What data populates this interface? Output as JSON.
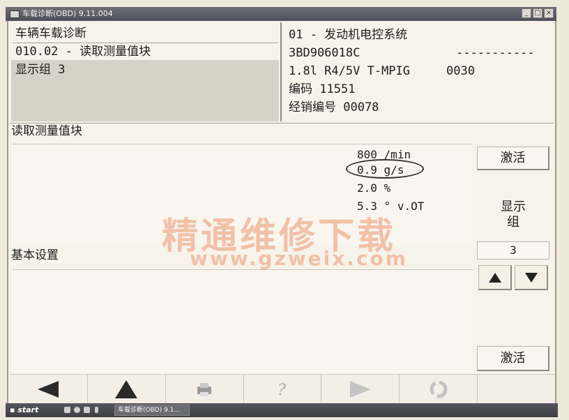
{
  "window": {
    "title": "车载诊断(OBD) 9.11.004",
    "btn_minimize": "_",
    "btn_maximize": "□",
    "btn_close": "×"
  },
  "header_left": {
    "line1": "车辆车载诊断",
    "line2": "010.02 - 读取测量值块",
    "line3": "显示组 3"
  },
  "header_right": {
    "line1": "01 - 发动机电控系统",
    "line2_part_no": "3BD906018C",
    "line2_dashes": "-----------",
    "line3_engine": "1.8l R4/5V T-MPIG",
    "line3_code": "0030",
    "line4": "编码 11551",
    "line5": "经销编号 00078"
  },
  "measuring_blocks": {
    "title": "读取测量值块",
    "values": [
      {
        "value": "800",
        "unit": "/min"
      },
      {
        "value": "0.9",
        "unit": "g/s"
      },
      {
        "value": "2.0",
        "unit": "%"
      },
      {
        "value": "5.3",
        "unit": "° v.OT"
      }
    ],
    "highlighted_index": 1
  },
  "basic_settings": {
    "title": "基本设置"
  },
  "side": {
    "activate_top": "激活",
    "display_group_label": "显示\n组",
    "display_group_value": "3",
    "activate_bottom": "激活"
  },
  "toolbar": {
    "icons": [
      "back-arrow-icon",
      "up-arrow-icon",
      "print-icon",
      "help-icon",
      "forward-arrow-icon",
      "refresh-icon"
    ]
  },
  "taskbar": {
    "start_label": "start",
    "task_label": "车载诊断(OBD) 9.1..."
  },
  "watermark": {
    "line1": "精通维修下载",
    "line2": "www.gzweix.com"
  },
  "colors": {
    "watermark": "#ec966e",
    "panel_gray": "#d7d2c7",
    "background": "#f7f3ea"
  }
}
